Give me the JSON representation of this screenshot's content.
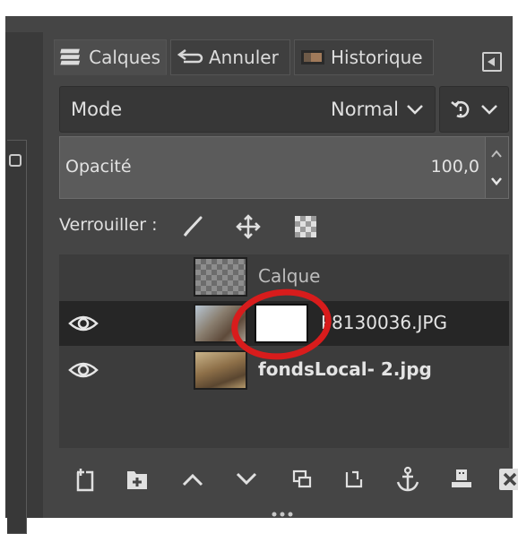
{
  "tabs": [
    {
      "label": "Calques",
      "icon": "layers-icon",
      "active": true
    },
    {
      "label": "Annuler",
      "icon": "undo-icon",
      "active": false
    },
    {
      "label": "Historique",
      "icon": "image-history-icon",
      "active": false
    }
  ],
  "mode": {
    "label": "Mode",
    "value": "Normal"
  },
  "opacity": {
    "label": "Opacité",
    "value": "100,0"
  },
  "lock": {
    "label": "Verrouiller :"
  },
  "layers": [
    {
      "name": "Calque",
      "visible": false,
      "selected": false
    },
    {
      "name": "P8130036.JPG",
      "visible": true,
      "selected": true,
      "has_mask": true
    },
    {
      "name": "fondsLocal- 2.jpg",
      "visible": true,
      "selected": false
    }
  ],
  "colors": {
    "panel_bg": "#454545",
    "selected_row": "#262626",
    "annotation_circle": "#d81c1c"
  }
}
